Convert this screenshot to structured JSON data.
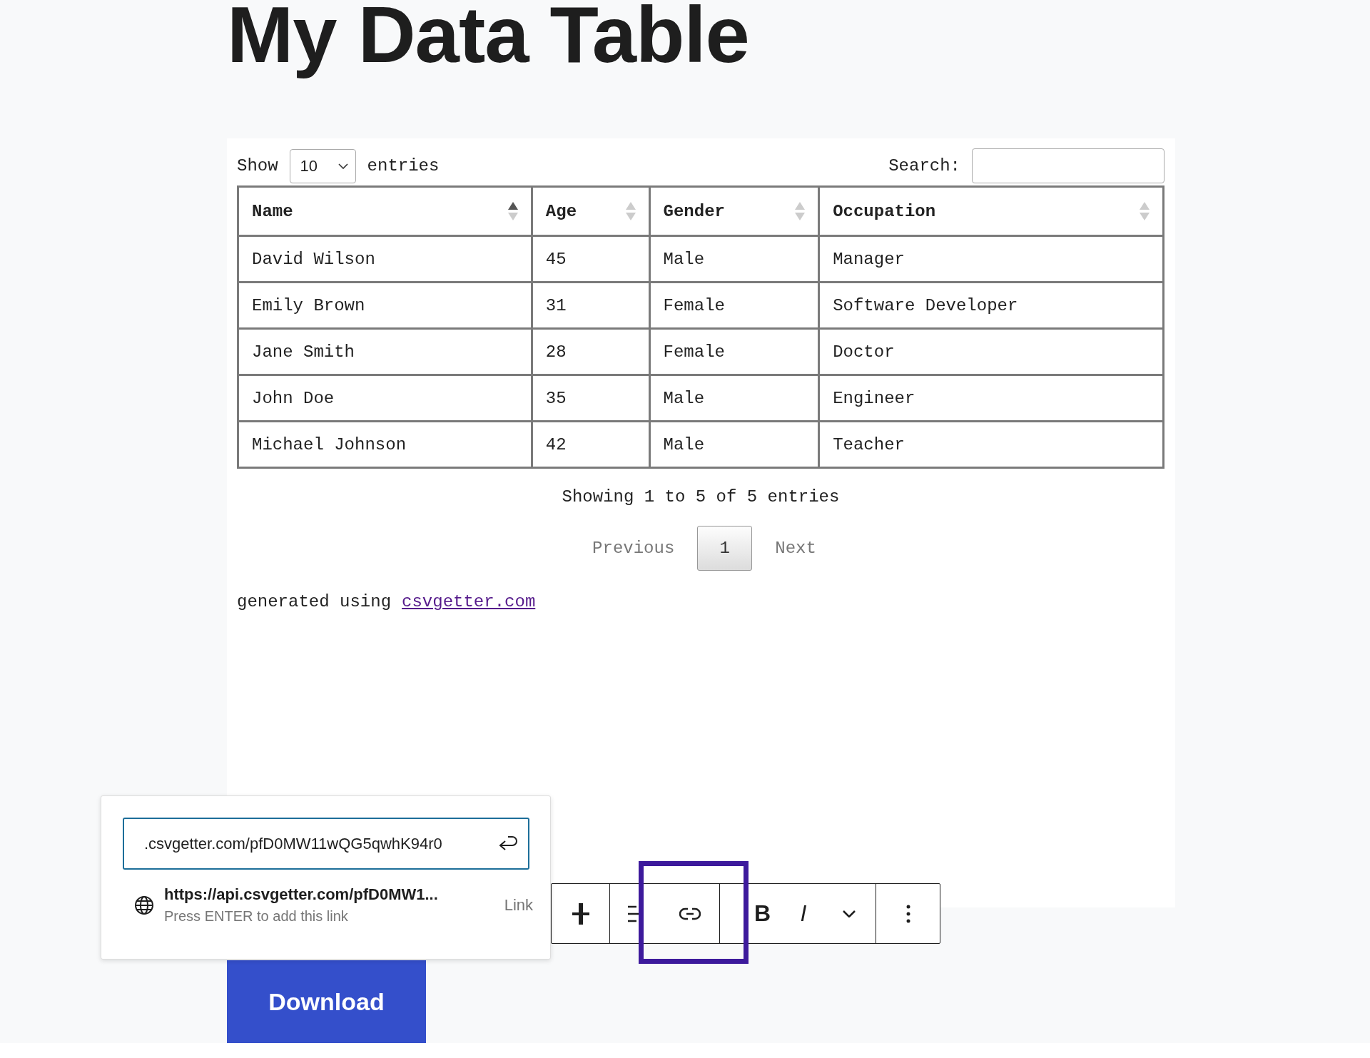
{
  "title": "My Data Table",
  "table_controls": {
    "show_label": "Show",
    "page_length": "10",
    "entries_label": "entries",
    "search_label": "Search:"
  },
  "columns": [
    {
      "label": "Name",
      "sorted_ascending": true
    },
    {
      "label": "Age",
      "sorted_ascending": false
    },
    {
      "label": "Gender",
      "sorted_ascending": false
    },
    {
      "label": "Occupation",
      "sorted_ascending": false
    }
  ],
  "rows": [
    [
      "David Wilson",
      "45",
      "Male",
      "Manager"
    ],
    [
      "Emily Brown",
      "31",
      "Female",
      "Software Developer"
    ],
    [
      "Jane Smith",
      "28",
      "Female",
      "Doctor"
    ],
    [
      "John Doe",
      "35",
      "Male",
      "Engineer"
    ],
    [
      "Michael Johnson",
      "42",
      "Male",
      "Teacher"
    ]
  ],
  "info": "Showing 1 to 5 of 5 entries",
  "pagination": {
    "previous": "Previous",
    "pages": [
      {
        "label": "1",
        "selected": true
      }
    ],
    "next": "Next"
  },
  "footer": {
    "text": "generated using",
    "link": "csvgetter.com"
  },
  "download_button": "Download",
  "link_popover": {
    "url_value": ".csvgetter.com/pfD0MW11wQG5qwhK94r0",
    "suggestion_title": "https://api.csvgetter.com/pfD0MW1...",
    "suggestion_hint": "Press ENTER to add this link",
    "suggestion_type": "Link"
  },
  "toolbar": [
    [
      {
        "kind": "block"
      }
    ],
    [
      {
        "kind": "align"
      },
      {
        "kind": "link",
        "highlighted": true
      }
    ],
    [
      {
        "kind": "bold",
        "label": "B"
      },
      {
        "kind": "italic",
        "label": "I"
      },
      {
        "kind": "chevron"
      }
    ],
    [
      {
        "kind": "more"
      }
    ]
  ]
}
